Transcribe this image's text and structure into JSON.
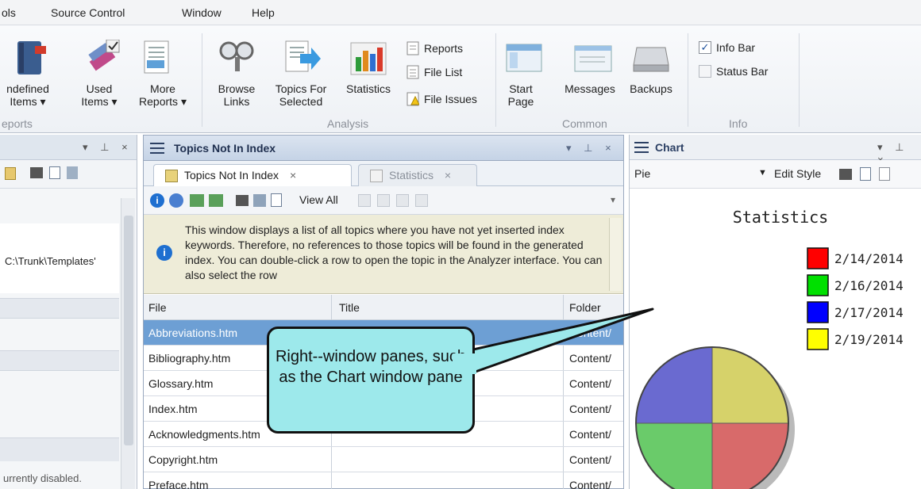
{
  "menu": [
    "ols",
    "Source Control",
    "Window",
    "Help"
  ],
  "ribbon": {
    "reports_group": {
      "label": "eports",
      "undefined_items": "ndefined\nItems ▾",
      "used_items": "Used\nItems ▾",
      "more_reports": "More\nReports ▾"
    },
    "analysis_group": {
      "label": "Analysis",
      "browse_links": "Browse\nLinks",
      "topics_for_selected": "Topics For\nSelected",
      "statistics": "Statistics",
      "reports": "Reports",
      "file_list": "File List",
      "file_issues": "File Issues"
    },
    "common_group": {
      "label": "Common",
      "start_page": "Start\nPage",
      "messages": "Messages",
      "backups": "Backups"
    },
    "info_group": {
      "label": "Info",
      "info_bar": "Info Bar",
      "info_bar_checked": true,
      "status_bar": "Status Bar",
      "status_bar_checked": false
    }
  },
  "left_pane": {
    "path_text": "C:\\Trunk\\Templates'",
    "status_text": "urrently disabled."
  },
  "center_pane": {
    "title": "Topics Not In Index",
    "tabs": [
      {
        "label": "Topics Not In Index",
        "close": "×",
        "active": true
      },
      {
        "label": "Statistics",
        "close": "×",
        "active": false
      }
    ],
    "view_all": "View All",
    "info_text": "This window displays a list of all topics where you have not yet inserted index keywords. Therefore, no references to those topics will be found in the generated index. You can double-click a row to open the topic in the Analyzer interface. You can also select the row",
    "columns": [
      "File",
      "Title",
      "Folder"
    ],
    "rows": [
      {
        "file": "Abbreviations.htm",
        "title": "",
        "folder": "Content/",
        "selected": true
      },
      {
        "file": "Bibliography.htm",
        "title": "",
        "folder": "Content/",
        "selected": false
      },
      {
        "file": "Glossary.htm",
        "title": "",
        "folder": "Content/",
        "selected": false
      },
      {
        "file": "Index.htm",
        "title": "",
        "folder": "Content/",
        "selected": false
      },
      {
        "file": "Acknowledgments.htm",
        "title": "",
        "folder": "Content/",
        "selected": false
      },
      {
        "file": "Copyright.htm",
        "title": "",
        "folder": "Content/",
        "selected": false
      },
      {
        "file": "Preface.htm",
        "title": "",
        "folder": "Content/",
        "selected": false
      }
    ]
  },
  "chart_pane": {
    "title": "Chart",
    "type_value": "Pie",
    "edit_style": "Edit Style"
  },
  "chart_data": {
    "type": "pie",
    "title": "Statistics",
    "categories": [
      "2/14/2014",
      "2/16/2014",
      "2/17/2014",
      "2/19/2014"
    ],
    "values": [
      25,
      25,
      25,
      25
    ],
    "colors": [
      "#ff0000",
      "#00e000",
      "#0000ff",
      "#ffff00"
    ],
    "slice_colors": [
      "#d86a6a",
      "#6acb6a",
      "#6a6ad0",
      "#d6d26a"
    ],
    "legend": "right"
  },
  "callout": {
    "text": "Right--window panes, such as the Chart window pane"
  }
}
